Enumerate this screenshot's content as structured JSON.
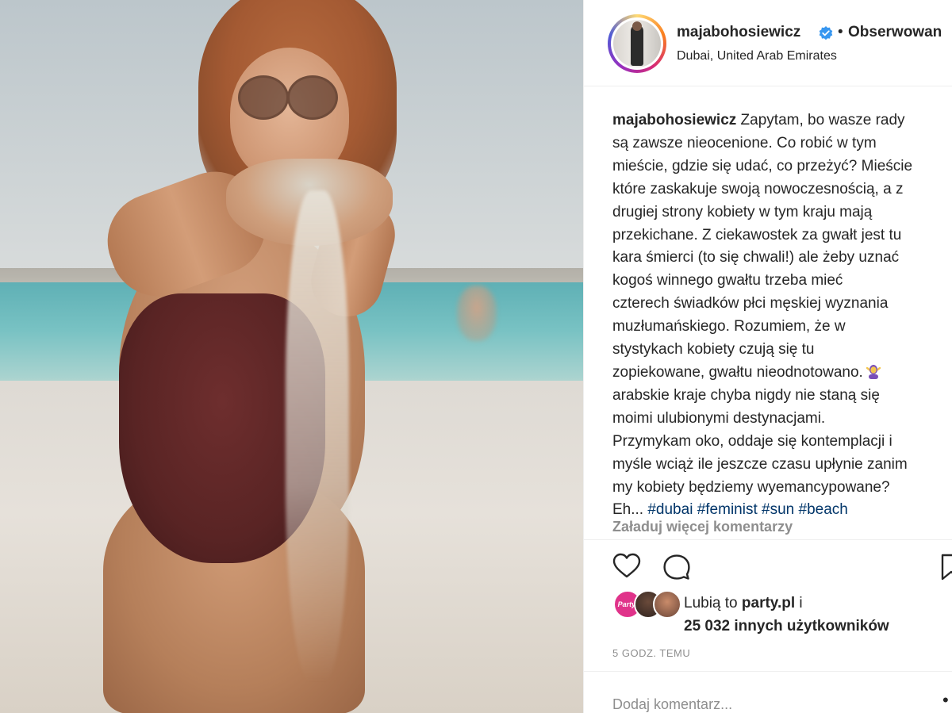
{
  "post": {
    "username": "majabohosiewicz",
    "follow_label": "Obserwowan",
    "separator": "•",
    "location": "Dubai, United Arab Emirates"
  },
  "caption": {
    "author": "majabohosiewicz",
    "lines": [
      " Zapytam, bo wasze rady",
      "są zawsze nieocenione. Co robić w tym",
      "mieście, gdzie się udać, co przeżyć? Mieście",
      "które zaskakuje swoją nowoczesnością, a z",
      "drugiej strony kobiety w tym kraju mają",
      "przekichane. Z ciekawostek za gwałt jest tu",
      "kara śmierci (to się chwali!) ale żeby uznać",
      "kogoś winnego gwałtu trzeba mieć",
      "czterech świadków płci męskiej wyznania",
      "muzłumańskiego. Rozumiem, że w",
      "stystykach kobiety czują się tu",
      "zopiekowane, gwałtu nieodnotowano.",
      "arabskie kraje chyba nigdy nie staną się",
      "moimi ulubionymi destynacjami.",
      "Przymykam oko, oddaje się kontemplacji i",
      "myśle wciąż ile jeszcze czasu upłynie zanim",
      "my kobiety będziemy wyemancypowane?"
    ],
    "last_line_prefix": "Eh... ",
    "hashtags": [
      "#dubai",
      "#feminist",
      "#sun",
      "#beach"
    ]
  },
  "comments": {
    "load_more_label": "Załaduj więcej komentarzy"
  },
  "actions": {
    "like_icon": "heart-icon",
    "comment_icon": "comment-icon",
    "save_icon": "bookmark-icon"
  },
  "likes": {
    "prefix": "Lubią to ",
    "top_liker": "party.pl",
    "connector": " i",
    "count": "25 032",
    "suffix": " innych użytkowników",
    "avatar_badge": "Party."
  },
  "timestamp": "5 GODZ. TEMU",
  "add_comment": {
    "placeholder": "Dodaj komentarz...",
    "more_label": "•"
  },
  "colors": {
    "text": "#262626",
    "muted": "#8e8e8e",
    "hashtag": "#003569",
    "verified": "#3897f0",
    "border": "#efefef"
  }
}
